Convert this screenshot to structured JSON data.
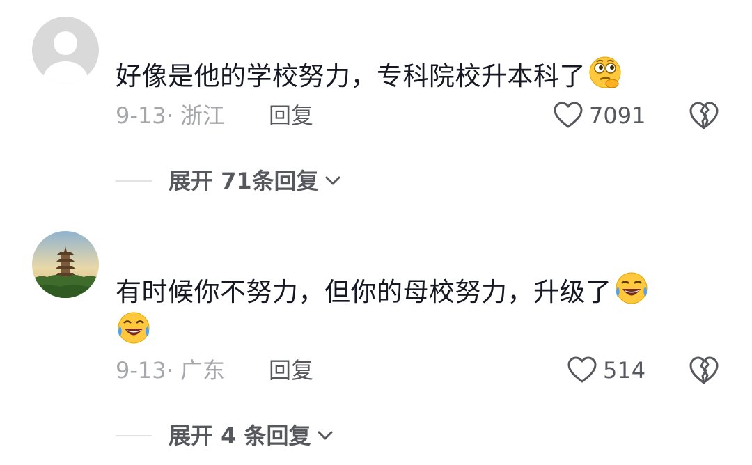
{
  "comments": [
    {
      "avatar": "default-avatar",
      "text": "好像是他的学校努力，专科院校升本科了",
      "emoji": [
        "thinking-emoji"
      ],
      "date_location": "9-13· 浙江",
      "reply_label": "回复",
      "like_count": "7091",
      "expand_label": "展开 71条回复"
    },
    {
      "avatar": "pagoda-landscape-avatar",
      "text_line1": "有时候你不努力，但你的母校努力，升级了",
      "emoji": [
        "laughing-crying-emoji",
        "laughing-crying-emoji"
      ],
      "date_location": "9-13· 广东",
      "reply_label": "回复",
      "like_count": "514",
      "expand_label": "展开 4 条回复"
    }
  ],
  "colors": {
    "primary_text": "#161823",
    "secondary_text": "#a6a7ab",
    "action_text": "#57585e",
    "divider": "#e3e3e6",
    "emoji_yellow": "#ffc83d"
  }
}
